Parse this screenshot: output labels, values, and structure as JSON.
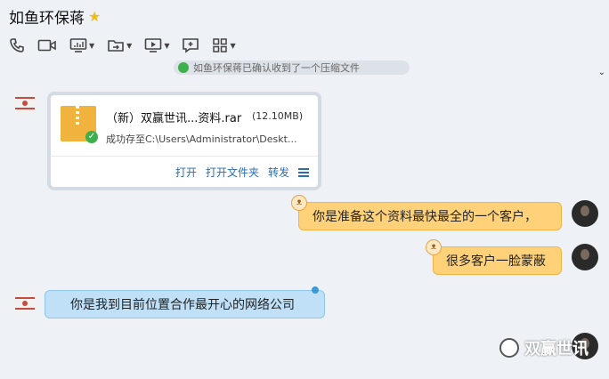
{
  "header": {
    "contact_name": "如鱼环保蒋",
    "star_icon": "star-icon"
  },
  "toolbar": {
    "buttons": [
      {
        "name": "phone-icon"
      },
      {
        "name": "video-icon"
      },
      {
        "name": "screen-share-icon"
      },
      {
        "name": "file-transfer-icon"
      },
      {
        "name": "remote-desktop-icon"
      },
      {
        "name": "add-message-icon"
      },
      {
        "name": "apps-icon"
      }
    ]
  },
  "notice": {
    "text": "如鱼环保蒋已确认收到了一个压缩文件"
  },
  "file_message": {
    "file_name": "（新）双赢世讯...资料.rar",
    "file_size": "(12.10MB)",
    "status": "成功存至C:\\Users\\Administrator\\Deskt...",
    "actions": {
      "open": "打开",
      "open_folder": "打开文件夹",
      "forward": "转发"
    }
  },
  "messages": [
    {
      "direction": "out",
      "text": "你是准备这个资料最快最全的一个客户，"
    },
    {
      "direction": "out",
      "text": "很多客户一脸蒙蔽"
    },
    {
      "direction": "in",
      "text": "你是我到目前位置合作最开心的网络公司"
    }
  ],
  "watermark": {
    "text": "双赢世讯"
  },
  "colors": {
    "background": "#eef2f7",
    "outgoing_bubble": "#ffd27a",
    "incoming_bubble": "#bfe0f7",
    "link": "#2a6db4",
    "success": "#3cb04b"
  }
}
